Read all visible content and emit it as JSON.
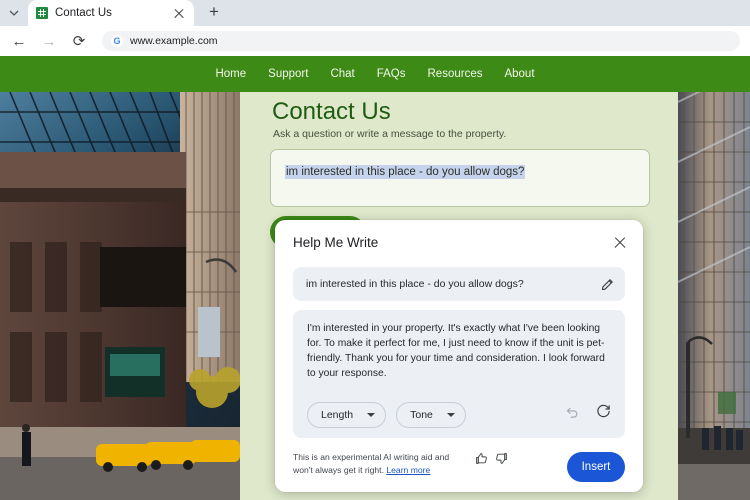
{
  "browser": {
    "tab": {
      "title": "Contact Us",
      "favicon": "sheets-icon",
      "close": "close-icon"
    },
    "tab_list_chevron": "chevron-down-icon",
    "new_tab": "+",
    "back": "←",
    "forward": "→",
    "reload": "⟳",
    "omnibox": {
      "url": "www.example.com",
      "logo": "G"
    }
  },
  "site": {
    "nav": [
      {
        "label": "Home"
      },
      {
        "label": "Support"
      },
      {
        "label": "Chat"
      },
      {
        "label": "FAQs"
      },
      {
        "label": "Resources"
      },
      {
        "label": "About"
      }
    ],
    "title": "Contact Us",
    "subtitle": "Ask a question or write a message to the property.",
    "message_value": "im interested in this place - do you allow dogs?",
    "accent_green": "#3d8a16",
    "page_background": "#dfe8cb",
    "title_color": "#1f5c12"
  },
  "help_me_write": {
    "title": "Help Me Write",
    "close_icon": "close-icon",
    "prompt": {
      "text": "im interested in this place - do you allow dogs?",
      "edit_icon": "pencil-icon"
    },
    "result": "I'm interested in your property. It's exactly what I've been looking for. To make it perfect for me, I just need to know if the unit is pet-friendly. Thank you for your time and consideration. I look forward to your response.",
    "controls": [
      {
        "label": "Length",
        "icon": "chevron-down-icon"
      },
      {
        "label": "Tone",
        "icon": "chevron-down-icon"
      }
    ],
    "actions": [
      {
        "name": "undo-icon",
        "state": "disabled"
      },
      {
        "name": "refresh-icon",
        "state": "enabled"
      }
    ],
    "disclaimer_text": "This is an experimental AI writing aid and won't always get it right. ",
    "learn_more": "Learn more",
    "feedback": [
      {
        "name": "thumbs-up-icon"
      },
      {
        "name": "thumbs-down-icon"
      }
    ],
    "insert_label": "Insert",
    "insert_color": "#1a56d6"
  }
}
